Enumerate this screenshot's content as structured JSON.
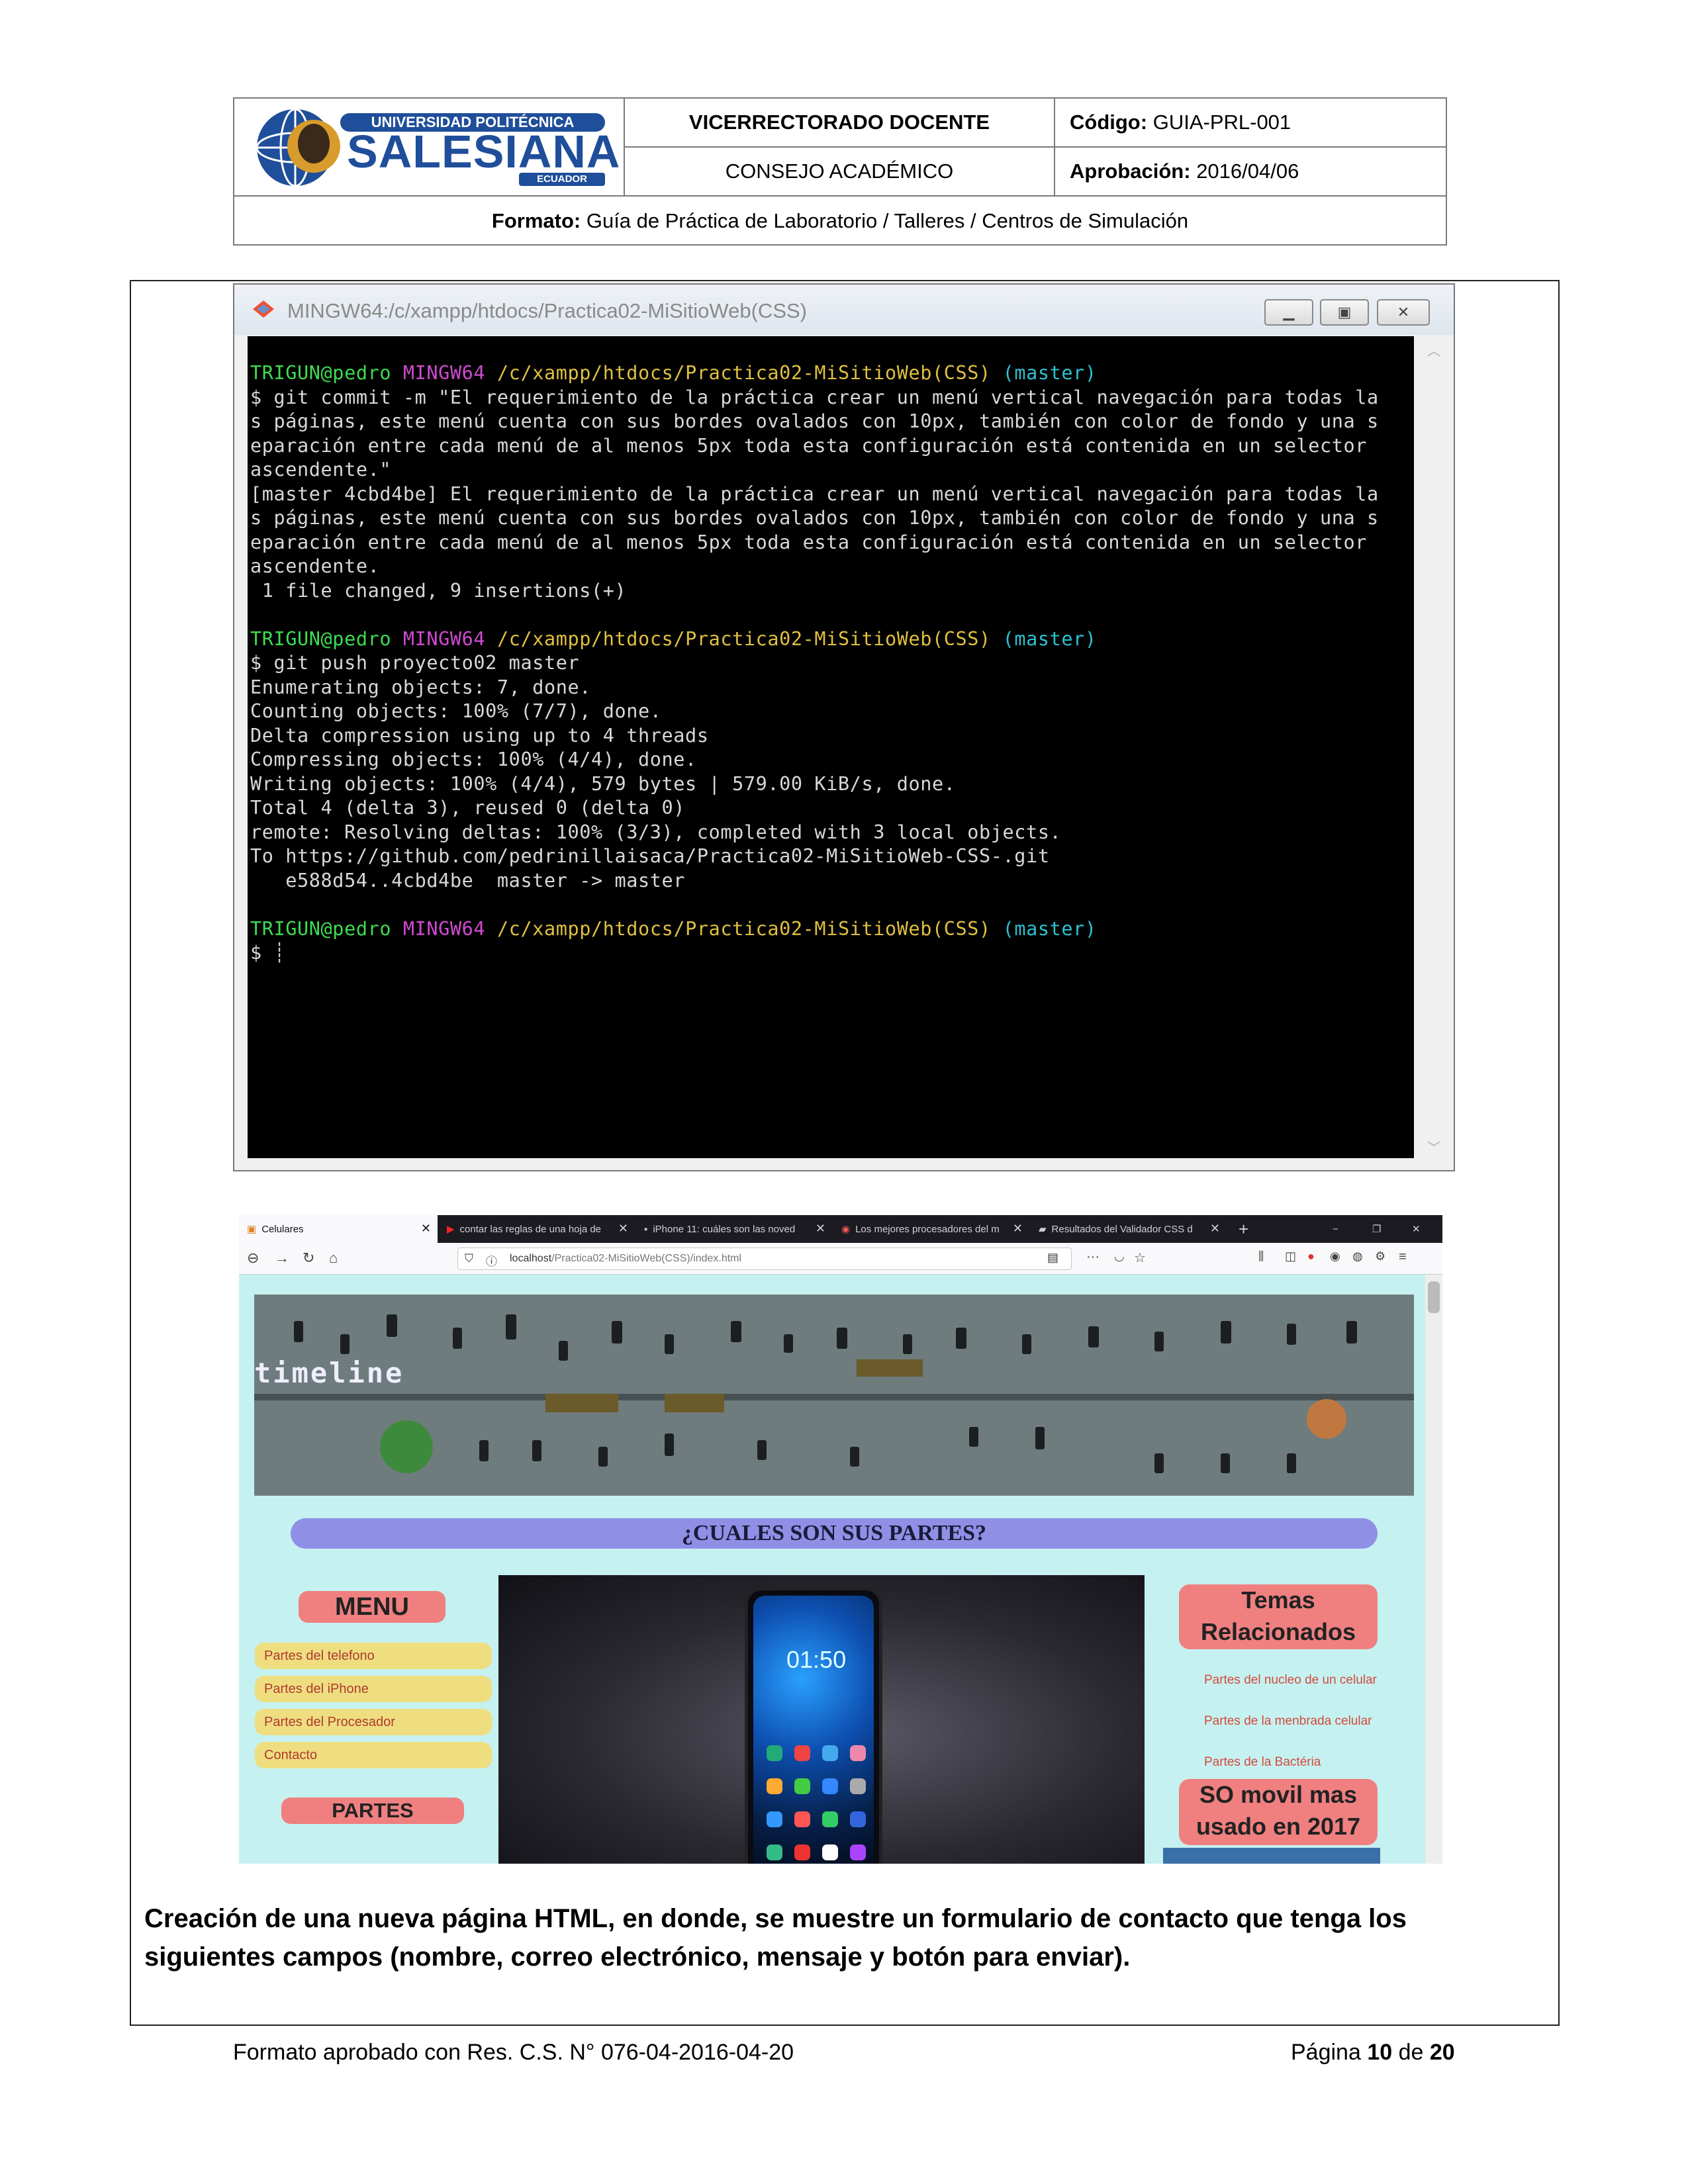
{
  "header": {
    "logo": {
      "line1": "UNIVERSIDAD POLITÉCNICA",
      "line2": "SALESIANA",
      "line3": "ECUADOR"
    },
    "vicerrectorado": "VICERRECTORADO DOCENTE",
    "consejo": "CONSEJO ACADÉMICO",
    "codigo_label": "Código:",
    "codigo_value": "GUIA-PRL-001",
    "aprobacion_label": "Aprobación:",
    "aprobacion_value": "2016/04/06",
    "formato_label": "Formato:",
    "formato_value": "Guía de Práctica de Laboratorio / Talleres / Centros de Simulación"
  },
  "terminal": {
    "title": "MINGW64:/c/xampp/htdocs/Practica02-MiSitioWeb(CSS)",
    "prompt": {
      "user": "TRIGUN@pedro",
      "shell": "MINGW64",
      "path": "/c/xampp/htdocs/Practica02-MiSitioWeb(CSS)",
      "branch": "(master)"
    },
    "block1": [
      "$ git commit -m \"El requerimiento de la práctica crear un menú vertical navegación para todas la",
      "s páginas, este menú cuenta con sus bordes ovalados con 10px, también con color de fondo y una s",
      "eparación entre cada menú de al menos 5px toda esta configuración está contenida en un selector",
      "ascendente.\"",
      "[master 4cbd4be] El requerimiento de la práctica crear un menú vertical navegación para todas la",
      "s páginas, este menú cuenta con sus bordes ovalados con 10px, también con color de fondo y una s",
      "eparación entre cada menú de al menos 5px toda esta configuración está contenida en un selector",
      "ascendente.",
      " 1 file changed, 9 insertions(+)"
    ],
    "block2": [
      "$ git push proyecto02 master",
      "Enumerating objects: 7, done.",
      "Counting objects: 100% (7/7), done.",
      "Delta compression using up to 4 threads",
      "Compressing objects: 100% (4/4), done.",
      "Writing objects: 100% (4/4), 579 bytes | 579.00 KiB/s, done.",
      "Total 4 (delta 3), reused 0 (delta 0)",
      "remote: Resolving deltas: 100% (3/3), completed with 3 local objects.",
      "To https://github.com/pedrinillaisaca/Practica02-MiSitioWeb-CSS-.git",
      "   e588d54..4cbd4be  master -> master"
    ],
    "cursor_line": "$ "
  },
  "browser": {
    "tabs": [
      {
        "label": "Celulares"
      },
      {
        "label": "contar las reglas de una hoja de"
      },
      {
        "label": "iPhone 11: cuáles son las noved"
      },
      {
        "label": "Los mejores procesadores del m"
      },
      {
        "label": "Resultados del Validador CSS d"
      }
    ],
    "url_host": "localhost",
    "url_path": "/Practica02-MiSitioWeb(CSS)/index.html",
    "banner_text": "timeline",
    "page_title": "¿CUALES SON SUS PARTES?",
    "menu_title": "MENU",
    "menu_items": [
      "Partes del telefono",
      "Partes del iPhone",
      "Partes del Procesador",
      "Contacto"
    ],
    "partes_title": "PARTES",
    "phone_clock": "01:50",
    "temas_title_1": "Temas",
    "temas_title_2": "Relacionados",
    "related_links": [
      "Partes del nucleo de un celular",
      "Partes de la menbrada celular",
      "Partes de la Bactéria"
    ],
    "so_title_1": "SO movil mas",
    "so_title_2": "usado en 2017"
  },
  "instruction": "Creación de una nueva página HTML, en donde, se muestre un formulario de contacto que tenga los siguientes campos (nombre, correo electrónico, mensaje y botón para enviar).",
  "footer": {
    "left": "Formato aprobado con Res. C.S. N° 076-04-2016-04-20",
    "page_label": "Página",
    "page_num": "10",
    "page_of": "de",
    "page_total": "20"
  },
  "colors": {
    "terminal_bg": "#000000",
    "prompt_user": "#3ddc50",
    "prompt_shell": "#d04ad0",
    "prompt_path": "#e0c040",
    "prompt_branch": "#2ec0d0",
    "site_bg": "#c6f1f1",
    "menu_item": "#eede80",
    "menu_header": "#f08080",
    "title_bar": "#8f8fe6"
  }
}
